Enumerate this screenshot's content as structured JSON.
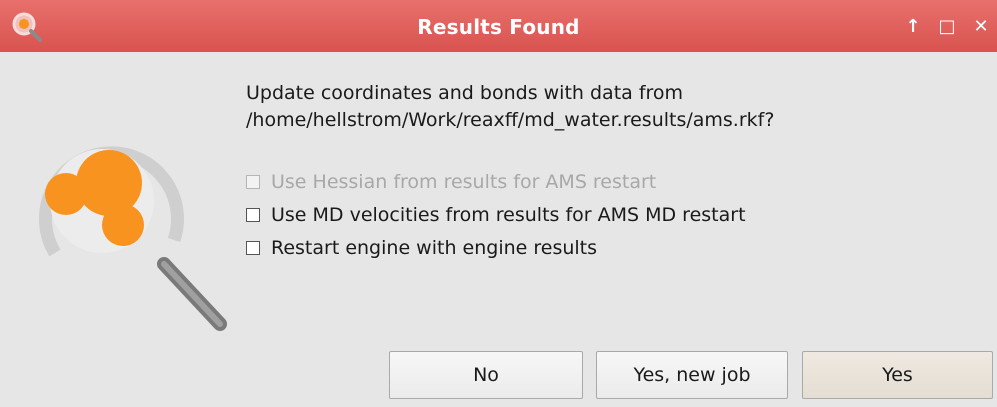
{
  "window": {
    "title": "Results Found",
    "controls": {
      "up_glyph": "↑",
      "maximize_glyph": "□",
      "close_glyph": "✕"
    }
  },
  "icons": {
    "title_icon": "magnifier-icon",
    "main_icon": "magnifier-molecule-icon"
  },
  "message": {
    "line1": "Update coordinates and bonds with data from",
    "line2": "/home/hellstrom/Work/reaxff/md_water.results/ams.rkf?"
  },
  "options": [
    {
      "label": "Use Hessian from results for AMS restart",
      "checked": false,
      "enabled": false
    },
    {
      "label": "Use MD velocities from results for AMS MD restart",
      "checked": false,
      "enabled": true
    },
    {
      "label": "Restart engine with engine results",
      "checked": false,
      "enabled": true
    }
  ],
  "buttons": {
    "no": "No",
    "new_job": "Yes, new job",
    "yes": "Yes"
  },
  "colors": {
    "titlebar": "#d9534f",
    "accent_orange": "#f7931e",
    "dialog_bg": "#e6e6e6"
  }
}
